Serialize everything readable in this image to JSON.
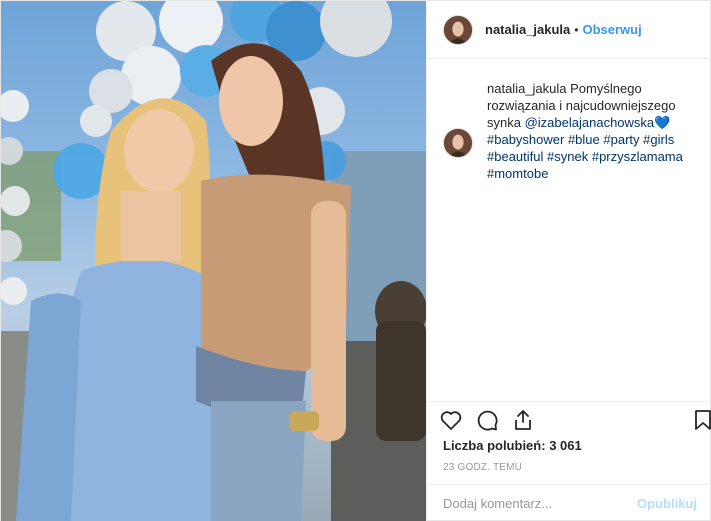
{
  "header": {
    "username": "natalia_jakula",
    "separator": "•",
    "follow_label": "Obserwuj"
  },
  "caption": {
    "username": "natalia_jakula",
    "text": "Pomyślnego rozwiązania i najcudowniejszego synka",
    "mention": "@izabelajanachowska",
    "emoji": "💙",
    "hashtags": [
      "#babyshower",
      "#blue",
      "#party",
      "#girls",
      "#beautiful",
      "#synek",
      "#przyszlamama",
      "#momtobe"
    ]
  },
  "actions": {
    "icons": [
      "heart-icon",
      "comment-icon",
      "share-icon",
      "bookmark-icon"
    ]
  },
  "likes": {
    "label": "Liczba polubień:",
    "count": "3 061"
  },
  "timestamp": "23 GODZ. TEMU",
  "comment": {
    "placeholder": "Dodaj komentarz...",
    "publish_label": "Opublikuj"
  },
  "colors": {
    "link": "#003569",
    "follow": "#3897f0",
    "publish_disabled": "#b2dffc",
    "emoji_heart": "#1ab0c4"
  }
}
